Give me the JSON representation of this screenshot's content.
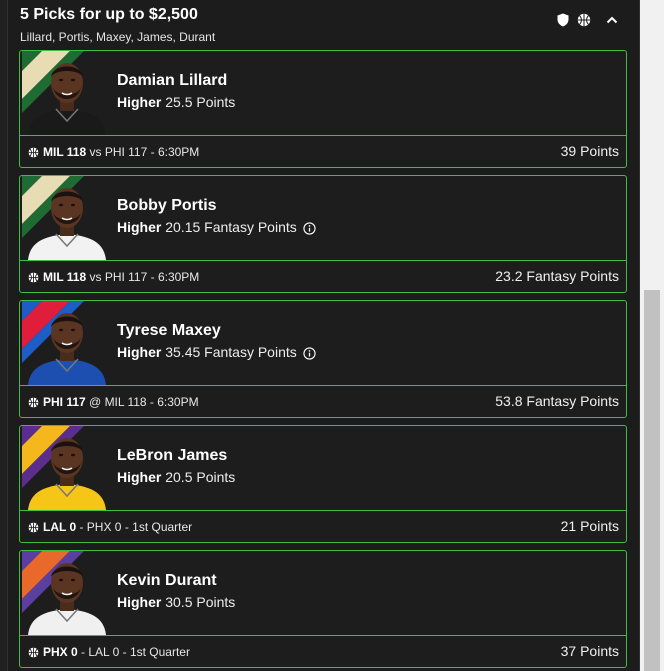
{
  "entry": {
    "title": "5 Picks for up to $2,500",
    "players_summary": "Lillard, Portis, Maxey, James, Durant"
  },
  "header_icons": [
    "shield-icon",
    "basketball-icon",
    "chevron-up-icon"
  ],
  "colors": {
    "card_border": "#3fbf3f",
    "panel_background": "#1c1c1c",
    "text": "#ffffff"
  },
  "picks": [
    {
      "player": "Damian Lillard",
      "direction": "Higher",
      "line": "25.5 Points",
      "info_icon": false,
      "team": "MIL 118",
      "separator": " vs ",
      "rest": "PHI 117 - 6:30PM",
      "result": "39 Points",
      "team_colors": [
        "#1e6b33",
        "#e8dcb5"
      ],
      "jersey_color": "#1a1a1a"
    },
    {
      "player": "Bobby Portis",
      "direction": "Higher",
      "line": "20.15 Fantasy Points",
      "info_icon": true,
      "team": "MIL 118",
      "separator": " vs ",
      "rest": "PHI 117 - 6:30PM",
      "result": "23.2 Fantasy Points",
      "team_colors": [
        "#1e6b33",
        "#e8dcb5"
      ],
      "jersey_color": "#f2f2f2"
    },
    {
      "player": "Tyrese Maxey",
      "direction": "Higher",
      "line": "35.45 Fantasy Points",
      "info_icon": true,
      "team": "PHI 117",
      "separator": " @ ",
      "rest": "MIL 118 - 6:30PM",
      "result": "53.8 Fantasy Points",
      "team_colors": [
        "#1d5dc8",
        "#e01e3c"
      ],
      "jersey_color": "#1d4fb0"
    },
    {
      "player": "LeBron James",
      "direction": "Higher",
      "line": "20.5 Points",
      "info_icon": false,
      "team": "LAL 0",
      "separator": " - ",
      "rest": "PHX 0 - 1st Quarter",
      "result": "21 Points",
      "team_colors": [
        "#5b2d8c",
        "#f5b81c"
      ],
      "jersey_color": "#f5c518"
    },
    {
      "player": "Kevin Durant",
      "direction": "Higher",
      "line": "30.5 Points",
      "info_icon": false,
      "team": "PHX 0",
      "separator": " - ",
      "rest": "LAL 0 - 1st Quarter",
      "result": "37 Points",
      "team_colors": [
        "#5b3fa0",
        "#e8692a"
      ],
      "jersey_color": "#f0f0f0"
    }
  ]
}
